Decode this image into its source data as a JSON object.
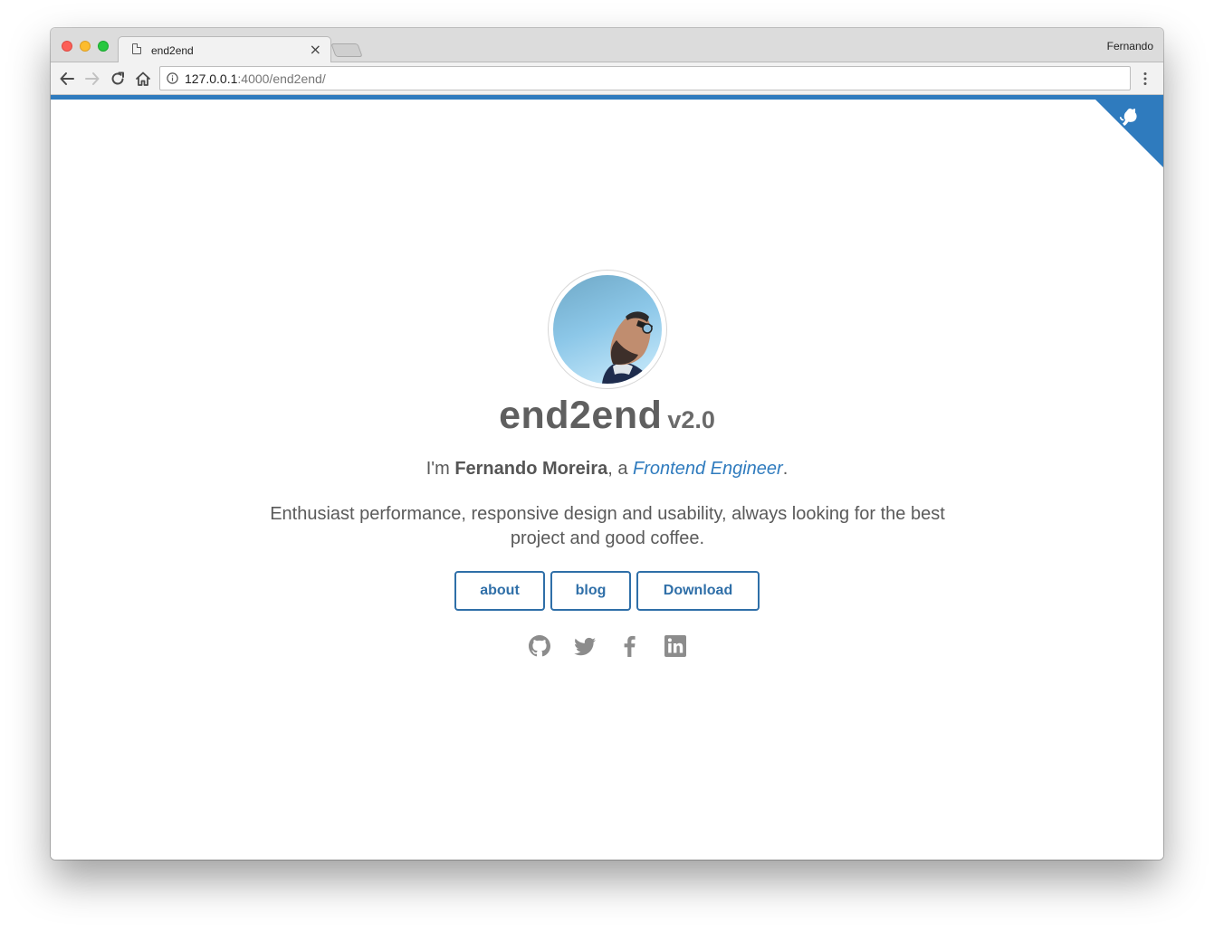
{
  "browser": {
    "tab_title": "end2end",
    "tab_close": "×",
    "profile_name": "Fernando",
    "url_host": "127.0.0.1",
    "url_rest": ":4000/end2end/"
  },
  "page": {
    "site_name": "end2end",
    "version": "v2.0",
    "intro": {
      "prefix": "I'm ",
      "name": "Fernando Moreira",
      "middle": ", a ",
      "role": "Frontend Engineer",
      "suffix": "."
    },
    "bio": "Enthusiast performance, responsive design and usability, always looking for the best project and good coffee.",
    "buttons": {
      "about": "about",
      "blog": "blog",
      "download": "Download"
    },
    "social_icons": [
      "github-icon",
      "twitter-icon",
      "facebook-icon",
      "linkedin-icon"
    ],
    "corner_icon": "github-octocat-icon"
  },
  "colors": {
    "accent": "#2f7bbe",
    "button_border": "#2f6fa8",
    "social_icon": "#8c8c8c",
    "text": "#5a5a5a"
  }
}
